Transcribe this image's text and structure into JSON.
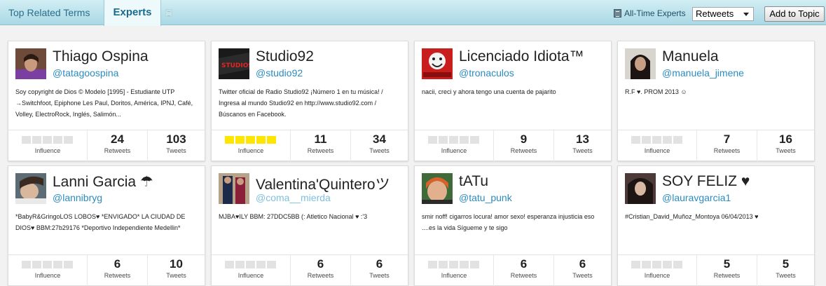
{
  "tabs": [
    {
      "label": "Top Related Terms"
    },
    {
      "label": "Experts"
    }
  ],
  "toolbar": {
    "alltime_label": "All-Time Experts",
    "sort_value": "Retweets",
    "add_button": "Add to Topic"
  },
  "labels": {
    "influence": "Influence",
    "retweets": "Retweets",
    "tweets": "Tweets"
  },
  "colors": {
    "accent": "#2b8bbf",
    "influence_on": "#ffe600",
    "influence_off": "#e2e2e2"
  },
  "experts": [
    {
      "name": "Thiago Ospina",
      "handle": "@tatagoospina",
      "bio": "Soy copyright de Dios © Modelo [1995] - Estudiante UTP →Switchfoot, Epiphone Les Paul, Doritos, América, IPNJ, Café, Volley, ElectroRock, Inglés, Salimón...",
      "influence": 0,
      "retweets": "24",
      "tweets": "103"
    },
    {
      "name": "Studio92",
      "handle": "@studio92",
      "bio": "Twitter oficial de Radio Studio92 ¡Número 1 en tu música! / Ingresa al mundo Studio92 en http://www.studio92.com / Búscanos en Facebook.",
      "influence": 5,
      "retweets": "11",
      "tweets": "34"
    },
    {
      "name": "Licenciado Idiota™",
      "handle": "@tronaculos",
      "bio": "nacii, creci y ahora tengo una cuenta de pajarito",
      "influence": 0,
      "retweets": "9",
      "tweets": "13"
    },
    {
      "name": "Manuela",
      "handle": "@manuela_jimene",
      "bio": "R.F ♥. PROM 2013 ☺",
      "influence": 0,
      "retweets": "7",
      "tweets": "16"
    },
    {
      "name": "Lanni Garcia ☂",
      "handle": "@lannibryg",
      "bio": "*BabyR&GringoLOS LOBOS♥ *ENVIGADO* LA CIUDAD DE DIOS♥ BBM:27b29176 *Deportivo Independiente Medellin*",
      "influence": 0,
      "retweets": "6",
      "tweets": "10"
    },
    {
      "name": "Valentina'Quinteroツ",
      "handle": "@coma__mierda",
      "bio": "MJBA♥ILY BBM: 27DDC5BB (: Atletico Nacional ♥ :'3",
      "influence": 0,
      "retweets": "6",
      "tweets": "6"
    },
    {
      "name": "tATu",
      "handle": "@tatu_punk",
      "bio": "smir noff! cigarros locura! amor sexo! esperanza injusticia eso ....es la vida Sígueme y te sigo",
      "influence": 0,
      "retweets": "6",
      "tweets": "6"
    },
    {
      "name": "SOY FELIZ ♥",
      "handle": "@lauravgarcia1",
      "bio": "#Cristian_David_Muñoz_Montoya 06/04/2013 ♥",
      "influence": 0,
      "retweets": "5",
      "tweets": "5"
    }
  ]
}
